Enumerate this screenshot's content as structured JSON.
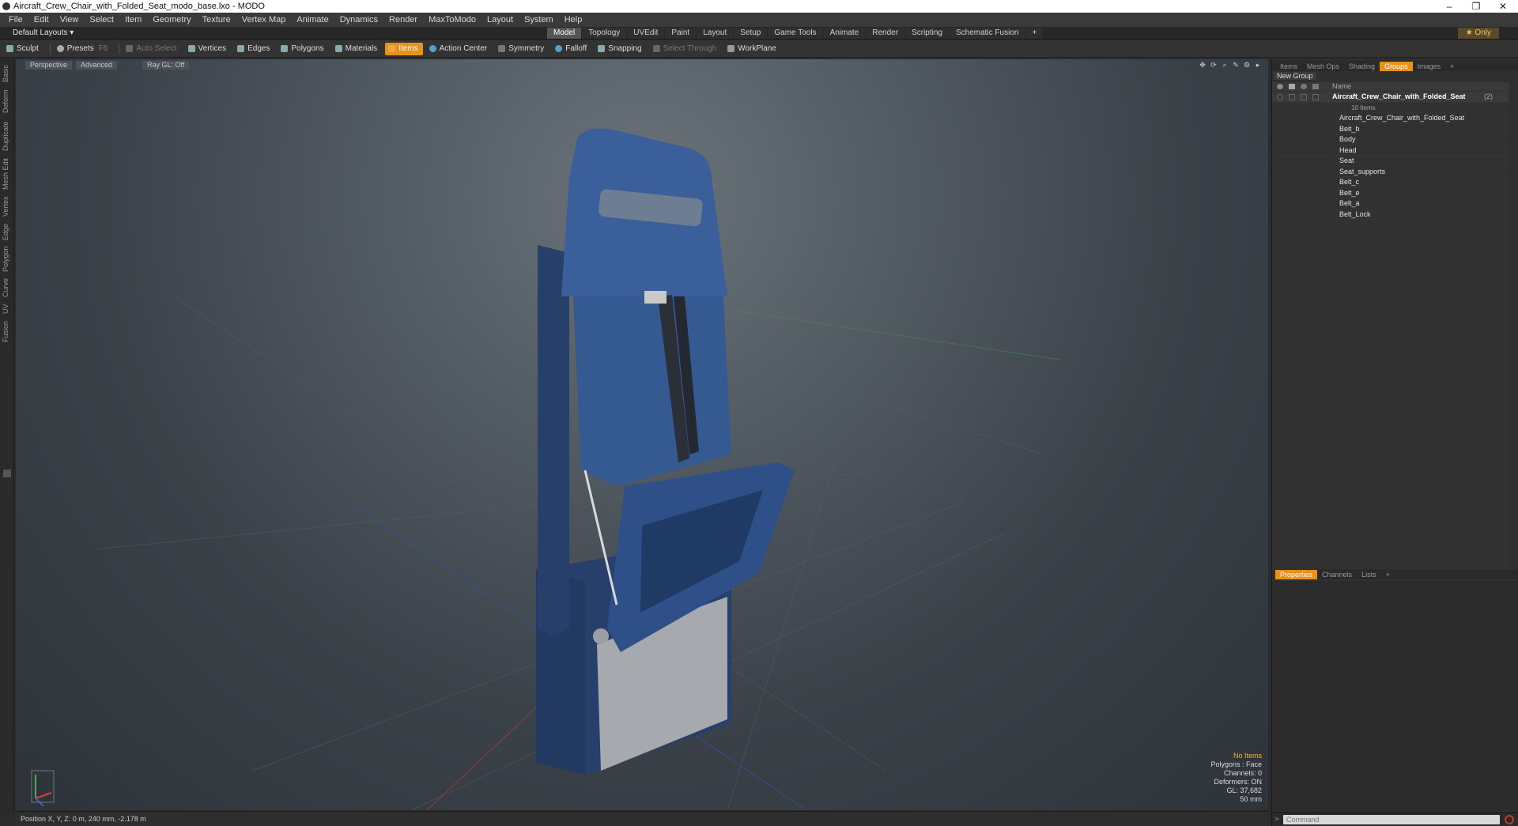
{
  "window": {
    "title": "Aircraft_Crew_Chair_with_Folded_Seat_modo_base.lxo - MODO",
    "buttons": {
      "minimize": "–",
      "restore": "❐",
      "close": "✕"
    }
  },
  "menu": [
    "File",
    "Edit",
    "View",
    "Select",
    "Item",
    "Geometry",
    "Texture",
    "Vertex Map",
    "Animate",
    "Dynamics",
    "Render",
    "MaxToModo",
    "Layout",
    "System",
    "Help"
  ],
  "layout": {
    "dropdown": "Default Layouts ▾",
    "tabs": [
      "Model",
      "Topology",
      "UVEdit",
      "Paint",
      "Layout",
      "Setup",
      "Game Tools",
      "Animate",
      "Render",
      "Scripting",
      "Schematic Fusion",
      "+"
    ],
    "active_tab": "Model",
    "only_label": "★ Only"
  },
  "toolbar": {
    "sculpt": "Sculpt",
    "presets": "Presets",
    "presets_key": "F6",
    "auto_select": "Auto Select",
    "vertices": "Vertices",
    "edges": "Edges",
    "polygons": "Polygons",
    "materials": "Materials",
    "items": "Items",
    "action_center": "Action Center",
    "symmetry": "Symmetry",
    "falloff": "Falloff",
    "snapping": "Snapping",
    "select_through": "Select Through",
    "workplane": "WorkPlane"
  },
  "left_tabs": [
    "Basic",
    "Deform",
    "Duplicate",
    "Mesh Edit",
    "Vertex",
    "Edge",
    "Polygon",
    "Curve",
    "UV",
    "Fusion"
  ],
  "viewport": {
    "view": "Perspective",
    "shading": "Advanced",
    "raygl": "Ray GL: Off",
    "hud": {
      "selection": "No Items",
      "polygons": "Polygons : Face",
      "channels": "Channels: 0",
      "deformers": "Deformers: ON",
      "gl": "GL: 37,682",
      "focal": "50 mm"
    }
  },
  "status": {
    "position": "Position X, Y, Z:  0 m, 240 mm, -2.178 m"
  },
  "right_panel": {
    "tabs": [
      "Items",
      "Mesh Ops",
      "Shading",
      "Groups",
      "Images",
      "+"
    ],
    "active_tab": "Groups",
    "new_group": "New Group",
    "column_name": "Name",
    "root": {
      "label": "Aircraft_Crew_Chair_with_Folded_Seat",
      "count": "(2)",
      "sub": "10 Items"
    },
    "items": [
      "Aircraft_Crew_Chair_with_Folded_Seat",
      "Belt_b",
      "Body",
      "Head",
      "Seat",
      "Seat_supports",
      "Belt_c",
      "Belt_e",
      "Belt_a",
      "Belt_Lock"
    ],
    "bottom_tabs": [
      "Properties",
      "Channels",
      "Lists",
      "+"
    ],
    "bottom_active": "Properties",
    "command_placeholder": "Command"
  },
  "colors": {
    "accent": "#e8921c",
    "hud_warn": "#f2b33a",
    "chair_blue": "#2f4a7c"
  }
}
